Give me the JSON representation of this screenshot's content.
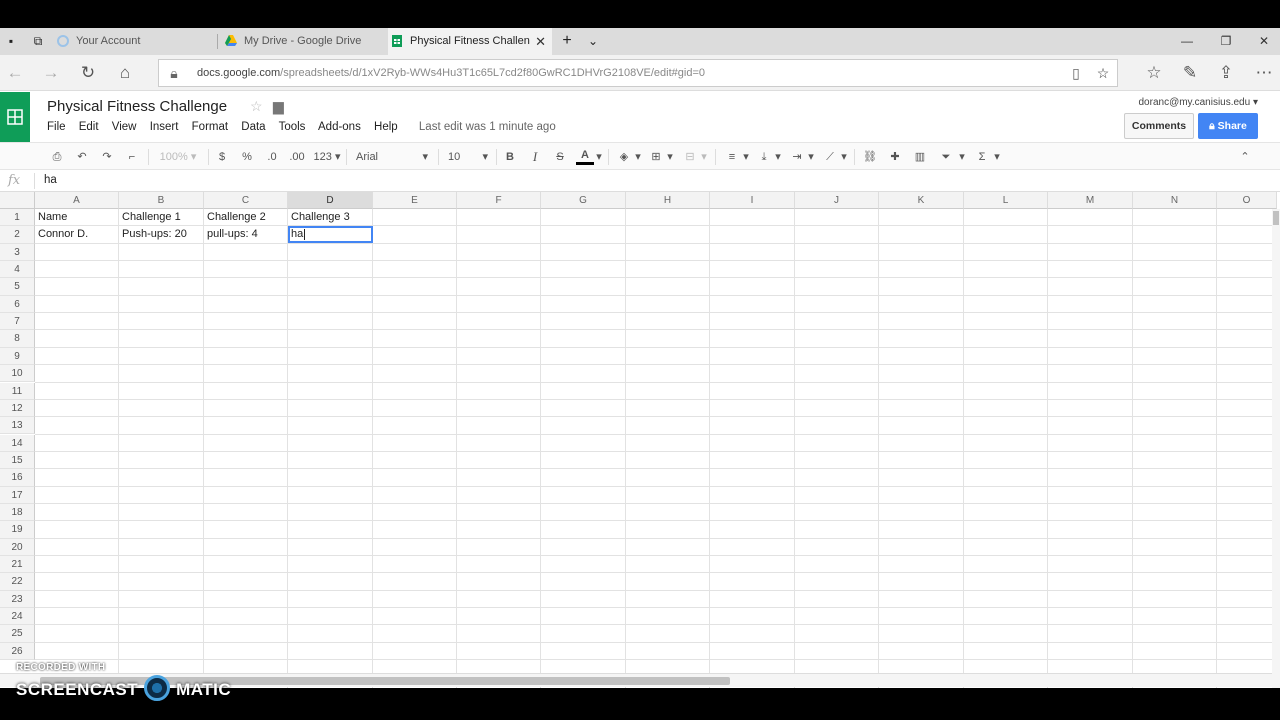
{
  "browser": {
    "tabs": [
      {
        "label": "Your Account",
        "active": false
      },
      {
        "label": "My Drive - Google Drive",
        "active": false
      },
      {
        "label": "Physical Fitness Challen",
        "active": true
      }
    ],
    "url_host": "docs.google.com",
    "url_path": "/spreadsheets/d/1xV2Ryb-WWs4Hu3T1c65L7cd2f80GwRC1DHVrG2108VE/edit#gid=0"
  },
  "sheet": {
    "title": "Physical Fitness Challenge",
    "menu": [
      "File",
      "Edit",
      "View",
      "Insert",
      "Format",
      "Data",
      "Tools",
      "Add-ons",
      "Help"
    ],
    "last_edit": "Last edit was 1 minute ago",
    "account": "doranc@my.canisius.edu",
    "comments_label": "Comments",
    "share_label": "Share"
  },
  "toolbar": {
    "zoom": "100%",
    "currency": "$",
    "percent": "%",
    "dec_decrease": ".0",
    "dec_increase": ".00",
    "more_formats": "123",
    "font": "Arial",
    "font_size": "10",
    "bold": "B",
    "italic": "I",
    "strike": "S",
    "textcolor": "A"
  },
  "formula_bar": {
    "fx": "fx",
    "value": "ha"
  },
  "grid": {
    "columns": [
      "A",
      "B",
      "C",
      "D",
      "E",
      "F",
      "G",
      "H",
      "I",
      "J",
      "K",
      "L",
      "M",
      "N",
      "O"
    ],
    "rows": [
      "1",
      "2",
      "3",
      "4",
      "5",
      "6",
      "7",
      "8",
      "9",
      "10",
      "11",
      "12",
      "13",
      "14",
      "15",
      "16",
      "17",
      "18",
      "19",
      "20",
      "21",
      "22",
      "23",
      "24",
      "25",
      "26"
    ],
    "cells": {
      "A1": "Name",
      "B1": "Challenge 1",
      "C1": "Challenge 2",
      "D1": "Challenge 3",
      "A2": "Connor D.",
      "B2": "Push-ups: 20",
      "C2": "pull-ups: 4",
      "D2": "ha"
    },
    "active_cell": "D2"
  },
  "watermark": {
    "line1": "RECORDED WITH",
    "line2a": "SCREENCAST",
    "line2b": "MATIC"
  }
}
